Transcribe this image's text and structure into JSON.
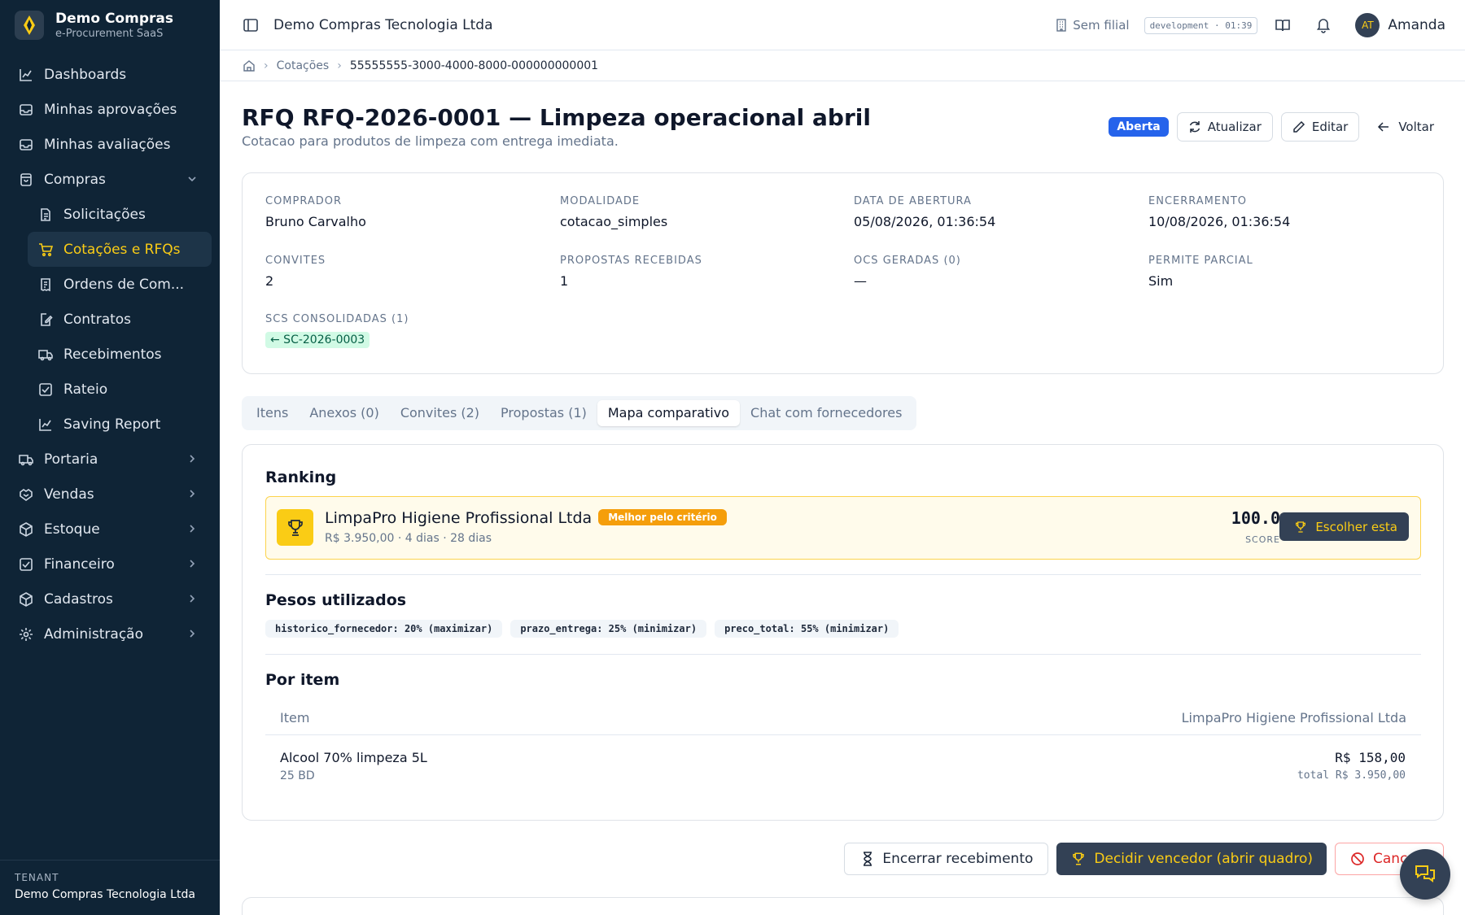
{
  "brand": {
    "name": "Demo Compras",
    "subtitle": "e-Procurement SaaS"
  },
  "sidebar": {
    "items": [
      {
        "label": "Dashboards",
        "icon": "chart-line-icon"
      },
      {
        "label": "Minhas aprovações",
        "icon": "inbox-icon"
      },
      {
        "label": "Minhas avaliações",
        "icon": "inbox-icon"
      },
      {
        "label": "Compras",
        "icon": "shopping-bag-icon",
        "expanded": true
      },
      {
        "label": "Portaria",
        "icon": "truck-icon"
      },
      {
        "label": "Vendas",
        "icon": "handshake-icon"
      },
      {
        "label": "Estoque",
        "icon": "box-icon"
      },
      {
        "label": "Financeiro",
        "icon": "check-square-icon"
      },
      {
        "label": "Cadastros",
        "icon": "box-icon"
      },
      {
        "label": "Administração",
        "icon": "gear-icon"
      }
    ],
    "compras_sub": [
      {
        "label": "Solicitações",
        "icon": "file-text-icon"
      },
      {
        "label": "Cotações e RFQs",
        "icon": "cart-icon",
        "active": true
      },
      {
        "label": "Ordens de Com...",
        "icon": "receipt-icon"
      },
      {
        "label": "Contratos",
        "icon": "file-edit-icon"
      },
      {
        "label": "Recebimentos",
        "icon": "truck-icon"
      },
      {
        "label": "Rateio",
        "icon": "check-square-icon"
      },
      {
        "label": "Saving Report",
        "icon": "chart-line-icon"
      }
    ],
    "tenant_label": "TENANT",
    "tenant_name": "Demo Compras Tecnologia Ltda"
  },
  "topbar": {
    "title": "Demo Compras Tecnologia Ltda",
    "filial": "Sem filial",
    "env": "development · 01:39",
    "avatar_initials": "AT",
    "user_name": "Amanda"
  },
  "breadcrumb": {
    "section": "Cotações",
    "current": "55555555-3000-4000-8000-000000000001"
  },
  "header": {
    "title": "RFQ RFQ-2026-0001 — Limpeza operacional abril",
    "subtitle": "Cotacao para produtos de limpeza com entrega imediata.",
    "status": "Aberta",
    "refresh_label": "Atualizar",
    "edit_label": "Editar",
    "back_label": "Voltar"
  },
  "info": {
    "comprador_label": "Comprador",
    "comprador": "Bruno Carvalho",
    "modalidade_label": "Modalidade",
    "modalidade": "cotacao_simples",
    "abertura_label": "Data de abertura",
    "abertura": "05/08/2026, 01:36:54",
    "encerramento_label": "Encerramento",
    "encerramento": "10/08/2026, 01:36:54",
    "convites_label": "Convites",
    "convites": "2",
    "propostas_label": "Propostas recebidas",
    "propostas": "1",
    "ocs_label": "OCs geradas (0)",
    "ocs": "—",
    "parcial_label": "Permite parcial",
    "parcial": "Sim",
    "scs_label": "SCs consolidadas (1)",
    "scs_chip": "← SC-2026-0003"
  },
  "tabs": [
    {
      "label": "Itens"
    },
    {
      "label": "Anexos (0)"
    },
    {
      "label": "Convites (2)"
    },
    {
      "label": "Propostas (1)"
    },
    {
      "label": "Mapa comparativo",
      "active": true
    },
    {
      "label": "Chat com fornecedores"
    }
  ],
  "map": {
    "ranking_title": "Ranking",
    "supplier": "LimpaPro Higiene Profissional Ltda",
    "best_badge": "Melhor pelo critério",
    "meta": "R$ 3.950,00 · 4 dias · 28 dias",
    "score": "100.0",
    "score_label": "SCORE",
    "choose_label": "Escolher esta",
    "weights_title": "Pesos utilizados",
    "weights": [
      "historico_fornecedor: 20% (maximizar)",
      "prazo_entrega: 25% (minimizar)",
      "preco_total: 55% (minimizar)"
    ],
    "per_item_title": "Por item",
    "col_item": "Item",
    "col_supplier": "LimpaPro Higiene Profissional Ltda",
    "row_item": "Alcool 70% limpeza 5L",
    "row_qty": "25 BD",
    "row_price": "R$ 158,00",
    "row_total": "total R$ 3.950,00"
  },
  "actions": {
    "close_label": "Encerrar recebimento",
    "decide_label": "Decidir vencedor (abrir quadro)",
    "cancel_label": "Cancelar"
  },
  "colors": {
    "sidebar_bg": "#0f2436",
    "accent_yellow": "#facc15",
    "status_blue": "#2563eb",
    "dark_button": "#334155"
  }
}
